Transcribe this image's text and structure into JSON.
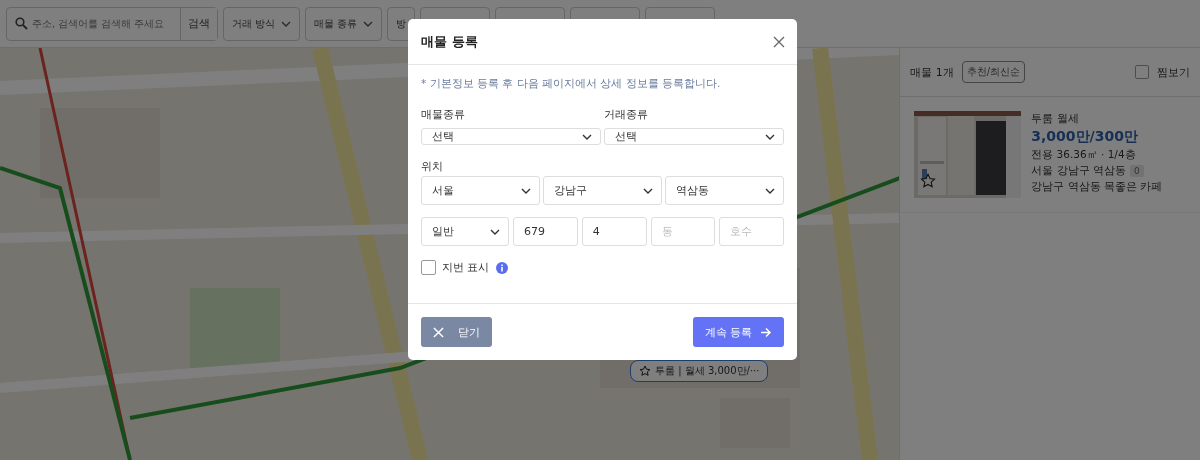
{
  "top_bar": {
    "search": {
      "placeholder": "주소, 검색어를 검색해 주세요",
      "button": "검색"
    },
    "filters": [
      {
        "label": "거래 방식",
        "dropdown": true
      },
      {
        "label": "매물 종류",
        "dropdown": true
      },
      {
        "label": "방",
        "dropdown": false
      }
    ]
  },
  "map": {
    "kind": "picture",
    "marker": {
      "label": "투룸 | 월세 3,000만/···"
    }
  },
  "listing_panel": {
    "count": "매물 1개",
    "sort": "추천/최신순",
    "favorites_filter": {
      "label": "찜보기",
      "checked": false
    },
    "listings": [
      {
        "title": "투룸 월세",
        "price": "3,000만/300만",
        "size": "전용 36.36㎡ · 1/4층",
        "address": "서울 강남구 역삼동",
        "badge": "0",
        "description": "강남구 역삼동 목좋은 카페",
        "favorite": false
      }
    ]
  },
  "dialog": {
    "title": "매물 등록",
    "notice": "* 기본정보 등록 후 다음 페이지에서 상세 정보를 등록합니다.",
    "property_type": {
      "label": "매물종류",
      "value": "선택"
    },
    "deal_type": {
      "label": "거래종류",
      "value": "선택"
    },
    "location": {
      "label": "위치",
      "city": "서울",
      "district": "강남구",
      "dong": "역삼동",
      "address_type": "일반",
      "main_number": "679",
      "sub_number": "4",
      "building": {
        "placeholder": "동"
      },
      "unit": {
        "placeholder": "호수"
      }
    },
    "show_lot_number": {
      "label": "지번 표시",
      "checked": false
    },
    "buttons": {
      "close": "닫기",
      "continue": "계속 등록"
    }
  }
}
